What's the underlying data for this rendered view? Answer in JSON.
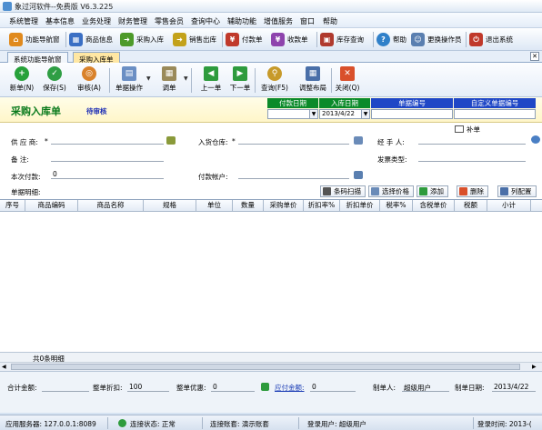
{
  "window": {
    "title": "象过河软件--免费版 V6.3.225"
  },
  "menu": [
    "系统管理",
    "基本信息",
    "业务处理",
    "财务管理",
    "零售会员",
    "查询中心",
    "辅助功能",
    "增值服务",
    "窗口",
    "帮助"
  ],
  "quickbar": [
    {
      "label": "功能导航窗",
      "icon": "navigation-icon",
      "color": "#e08a1e"
    },
    {
      "label": "商品信息",
      "icon": "product-grid-icon",
      "color": "#3a6fc4"
    },
    {
      "label": "采购入库",
      "icon": "purchase-arrow-icon",
      "color": "#4d9a2a"
    },
    {
      "label": "销售出库",
      "icon": "sales-arrow-icon",
      "color": "#c3a21b"
    },
    {
      "label": "付款单",
      "icon": "payment-icon",
      "color": "#c0392b"
    },
    {
      "label": "收款单",
      "icon": "receipt-icon",
      "color": "#8e44ad"
    },
    {
      "label": "库存查询",
      "icon": "inventory-icon",
      "color": "#b03a2e"
    },
    {
      "label": "帮助",
      "icon": "help-icon",
      "color": "#2f80c9"
    },
    {
      "label": "更换操作员",
      "icon": "switch-user-icon",
      "color": "#5a7fb0"
    },
    {
      "label": "退出系统",
      "icon": "exit-icon",
      "color": "#c0392b"
    }
  ],
  "tabs": [
    {
      "label": "系统功能导航窗",
      "active": false
    },
    {
      "label": "采购入库单",
      "active": true
    }
  ],
  "doc_toolbar": [
    {
      "label": "新单(N)",
      "icon": "new-icon",
      "color": "#27a13a",
      "glyph": "+"
    },
    {
      "label": "保存(S)",
      "icon": "save-check-icon",
      "color": "#2f9e44",
      "glyph": "✓"
    },
    {
      "label": "审核(A)",
      "icon": "audit-icon",
      "color": "#d9822b",
      "glyph": "◎"
    },
    {
      "label": "单据操作",
      "icon": "document-ops-icon",
      "color": "#6b8fc4",
      "glyph": "▤"
    },
    {
      "label": "调单",
      "icon": "clipboard-icon",
      "color": "#9a8a5a",
      "glyph": "▦"
    },
    {
      "label": "上一单",
      "icon": "prev-icon",
      "color": "#2e9b3d",
      "glyph": "◀"
    },
    {
      "label": "下一单",
      "icon": "next-icon",
      "color": "#2e9b3d",
      "glyph": "▶"
    },
    {
      "label": "查询(F5)",
      "icon": "search-icon",
      "color": "#c79a2a",
      "glyph": "⚲"
    },
    {
      "label": "调整布局",
      "icon": "layout-icon",
      "color": "#4a6fa8",
      "glyph": "▦"
    },
    {
      "label": "关闭(Q)",
      "icon": "close-icon",
      "color": "#d9502b",
      "glyph": "✕"
    }
  ],
  "header": {
    "title": "采购入库单",
    "status": "待审核",
    "cols": [
      "付款日期",
      "入库日期",
      "单据编号",
      "自定义单据编号"
    ],
    "payment_date": "",
    "inbound_date": "2013/4/22",
    "doc_no": "",
    "custom_doc_no": ""
  },
  "form": {
    "supplier_label": "供 应 商:",
    "warehouse_label": "入货仓库:",
    "handler_label": "经 手 人:",
    "remark_label": "备    注:",
    "invoice_type_label": "发票类型:",
    "paid_label": "本次付款:",
    "paid_value": "0",
    "account_label": "付款帐户:",
    "detail_label": "单据明细:",
    "supplement_label": "补单",
    "required_mark": "*"
  },
  "grid_buttons": [
    "条码扫描",
    "选择价格",
    "添加",
    "删除",
    "列配置"
  ],
  "grid": {
    "columns": [
      "序号",
      "商品编码",
      "商品名称",
      "规格",
      "单位",
      "数量",
      "采购单价",
      "折扣率%",
      "折扣单价",
      "税率%",
      "含税单价",
      "税额",
      "小计"
    ],
    "row_count": "共0条明细"
  },
  "totals": {
    "total_label": "合计金额:",
    "total_value": "",
    "discount_label": "整单折扣:",
    "discount_value": "100",
    "preferential_label": "整单优惠:",
    "preferential_value": "0",
    "payable_label": "应付金额:",
    "payable_value": "0",
    "maker_label": "制单人:",
    "maker_value": "超级用户",
    "make_date_label": "制单日期:",
    "make_date_value": "2013/4/22"
  },
  "statusbar": {
    "server": "应用服务器: 127.0.0.1:8089",
    "connection": "连接状态: 正常",
    "account": "连接账套: 演示账套",
    "user": "登录用户: 超级用户",
    "login_time": "登录时间: 2013-("
  }
}
